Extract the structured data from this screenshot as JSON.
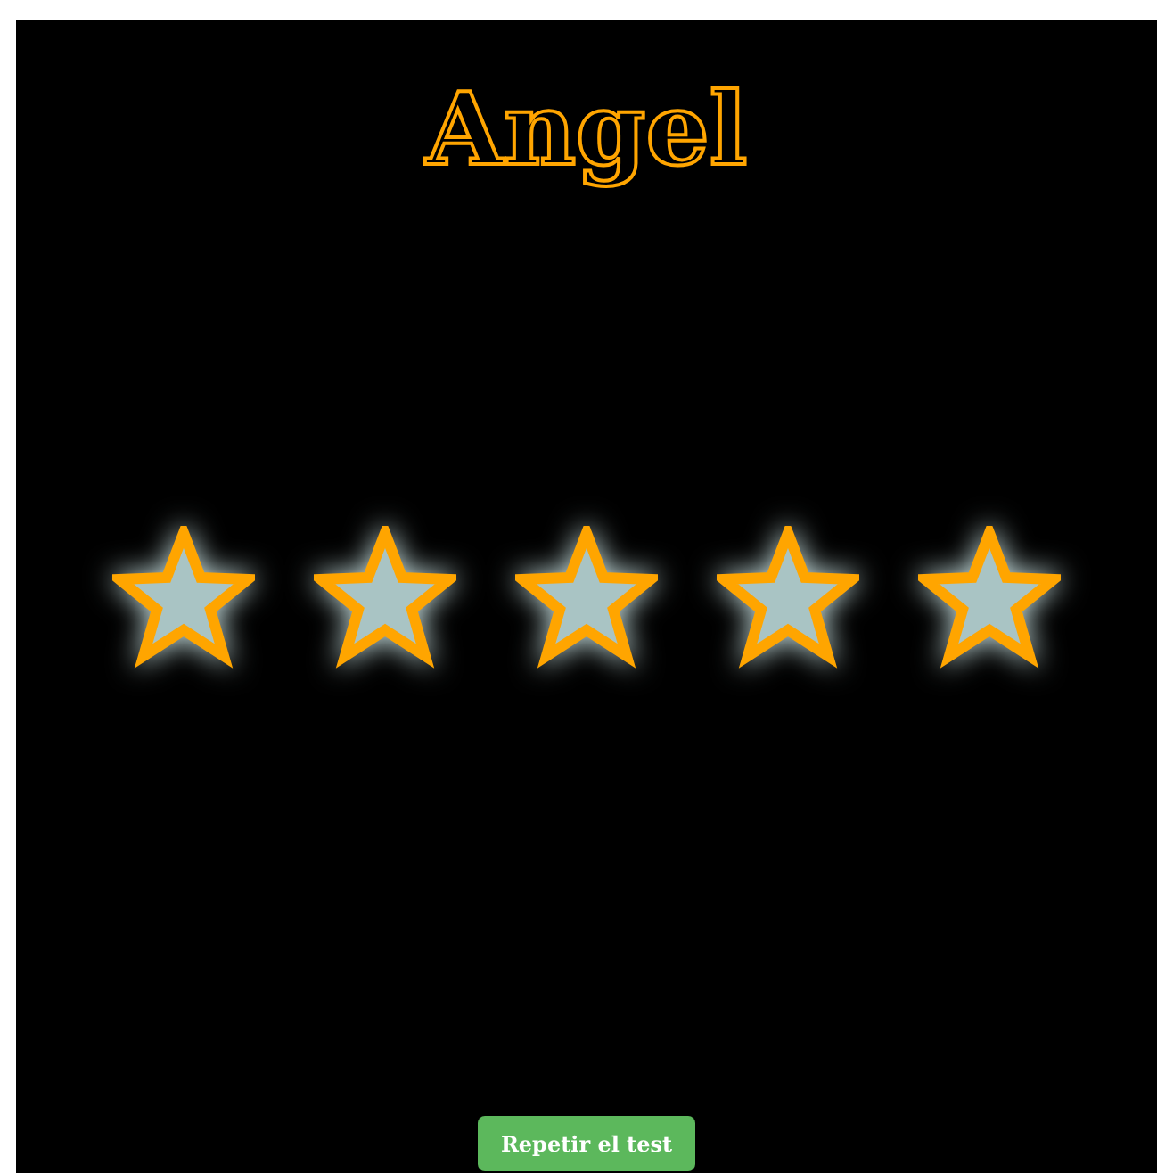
{
  "title": "Angel",
  "rating": {
    "stars": 5
  },
  "button": {
    "label": "Repetir el test"
  }
}
